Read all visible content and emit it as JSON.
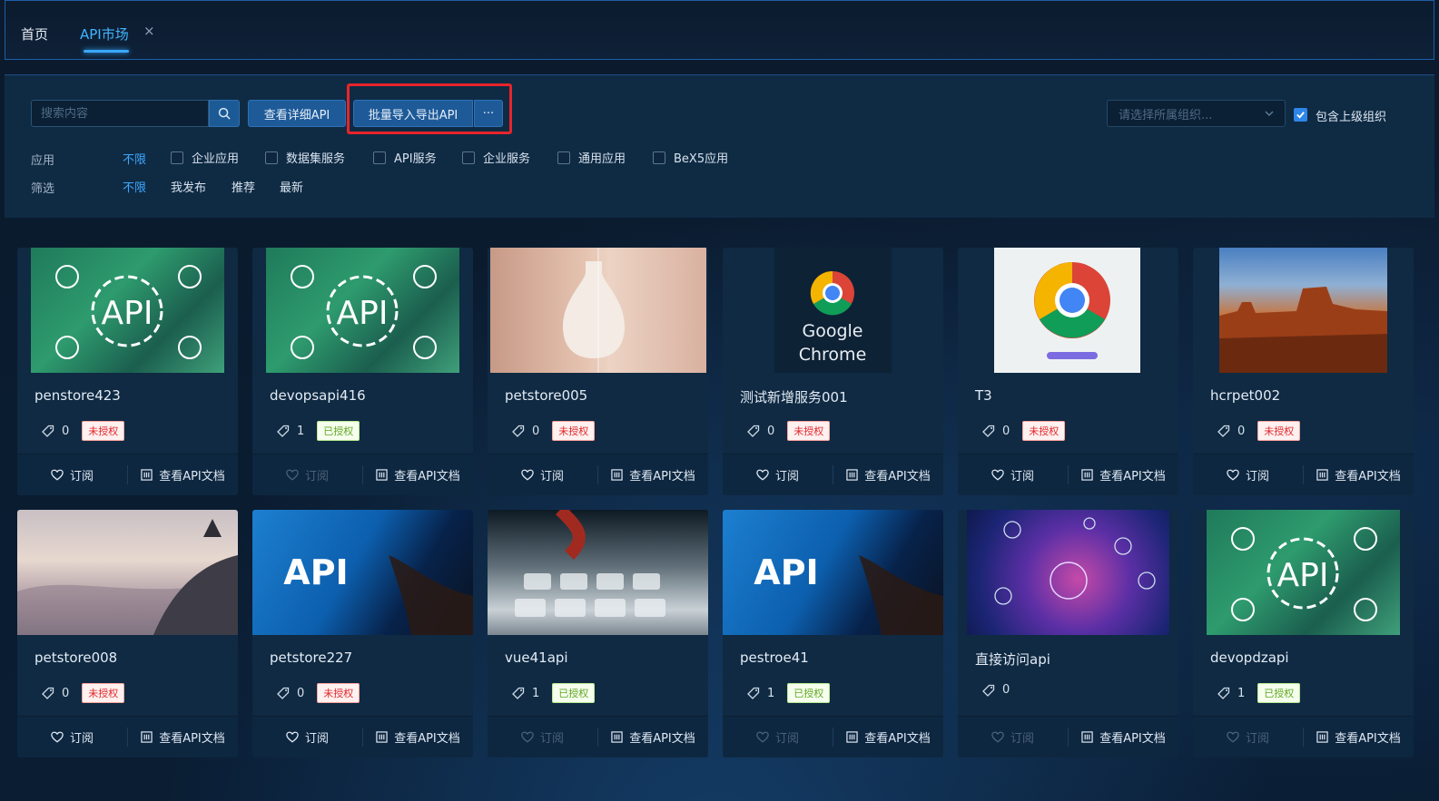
{
  "tabs": {
    "home": "首页",
    "api_market": "API市场",
    "close": "×"
  },
  "toolbar": {
    "search_placeholder": "搜索内容",
    "view_detail": "查看详细API",
    "batch_import": "批量导入导出API",
    "more": "···",
    "org_placeholder": "请选择所属组织...",
    "include_parent": "包含上级组织"
  },
  "filters": {
    "app_label": "应用",
    "app_all": "不限",
    "app_options": [
      "企业应用",
      "数据集服务",
      "API服务",
      "企业服务",
      "通用应用",
      "BeX5应用"
    ],
    "filter_label": "筛选",
    "filter_all": "不限",
    "filter_options": [
      "我发布",
      "推荐",
      "最新"
    ]
  },
  "card_actions": {
    "subscribe": "订阅",
    "view_doc": "查看API文档"
  },
  "badges": {
    "unauthorized": "未授权",
    "authorized": "已授权"
  },
  "chrome_text": {
    "line1": "Google",
    "line2": "Chrome"
  },
  "api_img_text": "API",
  "cards": [
    {
      "title": "penstore423",
      "count": "0",
      "status": "未授权"
    },
    {
      "title": "devopsapi416",
      "count": "1",
      "status": "已授权"
    },
    {
      "title": "petstore005",
      "count": "0",
      "status": "未授权"
    },
    {
      "title": "测试新增服务001",
      "count": "0",
      "status": "未授权"
    },
    {
      "title": "T3",
      "count": "0",
      "status": "未授权"
    },
    {
      "title": "hcrpet002",
      "count": "0",
      "status": "未授权"
    },
    {
      "title": "petstore008",
      "count": "0",
      "status": "未授权"
    },
    {
      "title": "petstore227",
      "count": "0",
      "status": "未授权"
    },
    {
      "title": "vue41api",
      "count": "1",
      "status": "已授权"
    },
    {
      "title": "pestroe41",
      "count": "1",
      "status": "已授权"
    },
    {
      "title": "直接访问api",
      "count": "0",
      "status": ""
    },
    {
      "title": "devopdzapi",
      "count": "1",
      "status": "已授权"
    }
  ],
  "colors": {
    "accent": "#3ea8ff",
    "button": "#1e5a97",
    "highlight": "#e8242a"
  }
}
